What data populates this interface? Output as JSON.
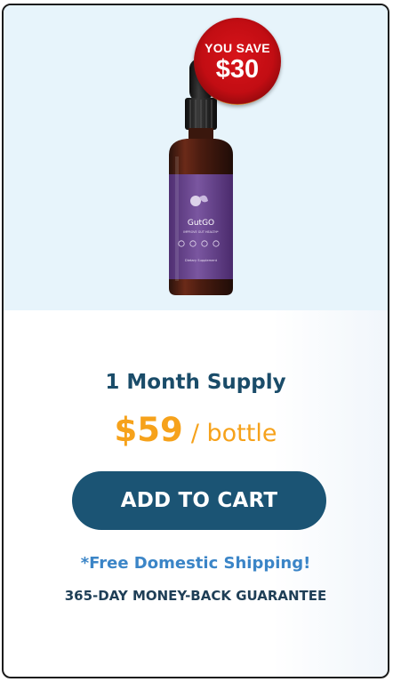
{
  "badge": {
    "label": "YOU SAVE",
    "amount": "$30"
  },
  "product": {
    "brand": "GutGO",
    "tagline": "IMPROVE GUT HEALTH*",
    "label_small": "Dietary Supplement"
  },
  "offer": {
    "supply": "1 Month Supply",
    "price": "$59",
    "unit": "/ bottle"
  },
  "actions": {
    "add_to_cart": "ADD TO CART"
  },
  "notes": {
    "shipping": "*Free Domestic Shipping!",
    "guarantee": "365-DAY MONEY-BACK GUARANTEE"
  },
  "colors": {
    "accent_price": "#f6a21b",
    "button_bg": "#1b5474",
    "heading": "#1a4c69",
    "shipping_text": "#3b85c7",
    "badge_red": "#c20d13"
  }
}
